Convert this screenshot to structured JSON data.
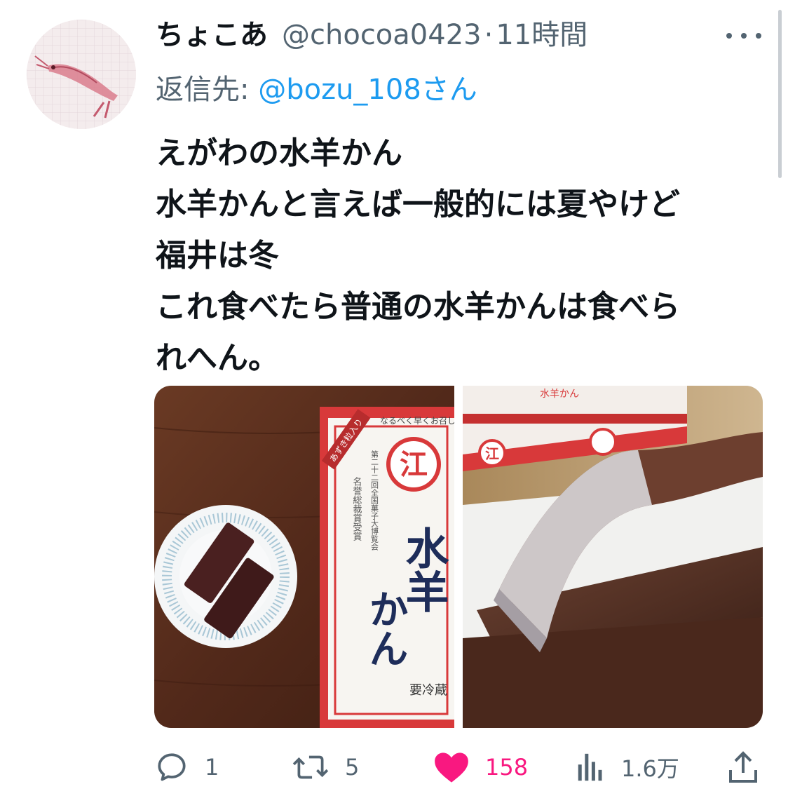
{
  "tweet": {
    "display_name": "ちょこあ",
    "handle": "@chocoa0423",
    "separator": "·",
    "time": "11時間",
    "reply_label": "返信先: ",
    "reply_handle": "@bozu_108さん",
    "text_lines": [
      "えがわの水羊かん",
      "水羊かんと言えば一般的には夏やけど",
      "福井は冬",
      "これ食べたら普通の水羊かんは食べら",
      "れへん。"
    ]
  },
  "media": {
    "left_image": {
      "box_top_label": "なるべく早くお召し",
      "box_ribbon": "あずき粒入り",
      "box_logo": "江",
      "box_title_line1": "水羊",
      "box_title_line2": "かん",
      "box_award_line1": "第二十二回全国菓子大博覧会",
      "box_award_line2": "名誉総裁賞受賞",
      "box_bottom_label": "要冷蔵"
    },
    "right_image": {
      "box_logo": "江",
      "box_label": "水羊かん"
    }
  },
  "actions": {
    "reply_count": "1",
    "retweet_count": "5",
    "like_count": "158",
    "views_count": "1.6万"
  },
  "colors": {
    "text": "#0f1419",
    "secondary": "#536471",
    "link": "#1d9bf0",
    "like": "#f91880"
  },
  "icons": {
    "reply": "reply-icon",
    "retweet": "retweet-icon",
    "like": "heart-icon",
    "views": "views-icon",
    "share": "share-icon",
    "more": "more-icon"
  }
}
